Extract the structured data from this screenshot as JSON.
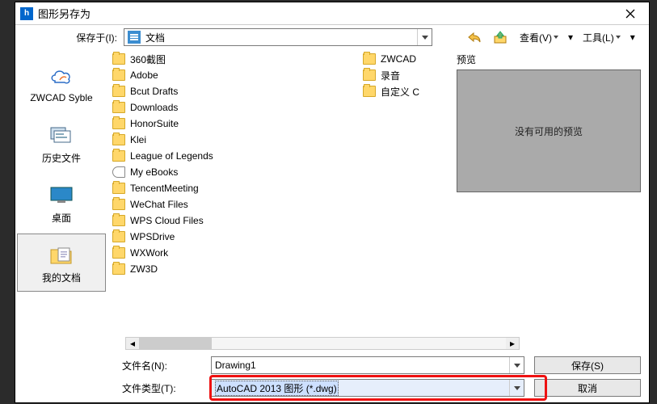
{
  "titlebar": {
    "title": "图形另存为"
  },
  "toprow": {
    "save_in_label": "保存于(I):",
    "location": "文档",
    "view_label": "查看(V)",
    "tools_label": "工具(L)"
  },
  "sidebar": {
    "items": [
      {
        "label": "ZWCAD Syble"
      },
      {
        "label": "历史文件"
      },
      {
        "label": "桌面"
      },
      {
        "label": "我的文档"
      }
    ]
  },
  "files_col1": [
    "360截图",
    "Adobe",
    "Bcut Drafts",
    "Downloads",
    "HonorSuite",
    "Klei",
    "League of Legends",
    "My eBooks",
    "TencentMeeting",
    "WeChat Files",
    "WPS Cloud Files",
    "WPSDrive",
    "WXWork",
    "ZW3D"
  ],
  "files_col2": [
    "ZWCAD",
    "录音",
    "自定义 C"
  ],
  "preview": {
    "label": "预览",
    "empty_text": "没有可用的预览"
  },
  "bottom": {
    "filename_label": "文件名(N):",
    "filename_value": "Drawing1",
    "filetype_label": "文件类型(T):",
    "filetype_value": "AutoCAD 2013 图形 (*.dwg)",
    "save_btn": "保存(S)",
    "cancel_btn": "取消"
  }
}
